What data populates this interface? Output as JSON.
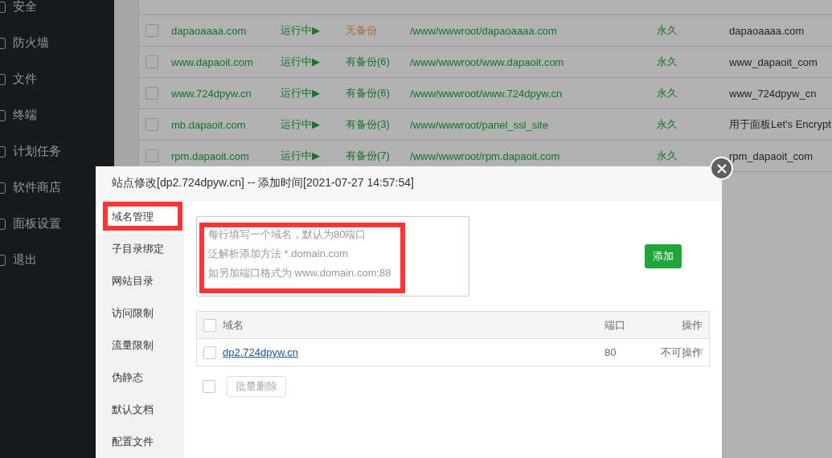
{
  "sidebar": {
    "items": [
      {
        "label": "安全"
      },
      {
        "label": "防火墙"
      },
      {
        "label": "文件"
      },
      {
        "label": "终端"
      },
      {
        "label": "计划任务"
      },
      {
        "label": "软件商店"
      },
      {
        "label": "面板设置"
      },
      {
        "label": "退出"
      }
    ]
  },
  "sites": [
    {
      "checked": false,
      "name": "dapaoaaaa.com",
      "status": {
        "kind": "running",
        "text": "运行中▶"
      },
      "backup": {
        "kind": "none",
        "text": "无备份"
      },
      "path": "/www/wwwroot/dapaoaaaa.com",
      "expiry": {
        "kind": "permanent",
        "text": "永久"
      },
      "remark": "dapaoaaaa.com"
    },
    {
      "checked": false,
      "name": "www.dapaoit.com",
      "status": {
        "kind": "running",
        "text": "运行中▶"
      },
      "backup": {
        "kind": "some",
        "text": "有备份(6)"
      },
      "path": "/www/wwwroot/www.dapaoit.com",
      "expiry": {
        "kind": "permanent",
        "text": "永久"
      },
      "remark": "www_dapaoit_com"
    },
    {
      "checked": false,
      "name": "www.724dpyw.cn",
      "status": {
        "kind": "running",
        "text": "运行中▶"
      },
      "backup": {
        "kind": "some",
        "text": "有备份(6)"
      },
      "path": "/www/wwwroot/www.724dpyw.cn",
      "expiry": {
        "kind": "permanent",
        "text": "永久"
      },
      "remark": "www_724dpyw_cn"
    },
    {
      "checked": false,
      "name": "mb.dapaoit.com",
      "status": {
        "kind": "running",
        "text": "运行中▶"
      },
      "backup": {
        "kind": "some",
        "text": "有备份(3)"
      },
      "path": "/www/wwwroot/panel_ssl_site",
      "expiry": {
        "kind": "permanent",
        "text": "永久"
      },
      "remark": "用于面板Let's Encrypt"
    },
    {
      "checked": false,
      "name": "rpm.dapaoit.com",
      "status": {
        "kind": "running",
        "text": "运行中▶"
      },
      "backup": {
        "kind": "some",
        "text": "有备份(7)"
      },
      "path": "/www/wwwroot/rpm.dapaoit.com",
      "expiry": {
        "kind": "permanent",
        "text": "永久"
      },
      "remark": "rpm_dapaoit_com"
    }
  ],
  "modal": {
    "title": "站点修改[dp2.724dpyw.cn] -- 添加时间[2021-07-27 14:57:54]",
    "tabs": [
      {
        "label": "域名管理",
        "selected": true
      },
      {
        "label": "子目录绑定",
        "selected": false
      },
      {
        "label": "网站目录",
        "selected": false
      },
      {
        "label": "访问限制",
        "selected": false
      },
      {
        "label": "流量限制",
        "selected": false
      },
      {
        "label": "伪静态",
        "selected": false
      },
      {
        "label": "默认文档",
        "selected": false
      },
      {
        "label": "配置文件",
        "selected": false
      }
    ],
    "domain_input": {
      "placeholder_lines": [
        "每行填写一个域名，默认为80端口",
        "泛解析添加方法 *.domain.com",
        "如另加端口格式为 www.domain.com:88"
      ]
    },
    "add_button": "添加",
    "table": {
      "header_checked": false,
      "columns": [
        "域名",
        "端口",
        "操作"
      ],
      "rows": [
        {
          "checked": false,
          "domain": "dp2.724dpyw.cn",
          "port": "80",
          "action": "不可操作"
        }
      ]
    },
    "footer_checked": false,
    "batch_delete_button": "批量删除"
  }
}
